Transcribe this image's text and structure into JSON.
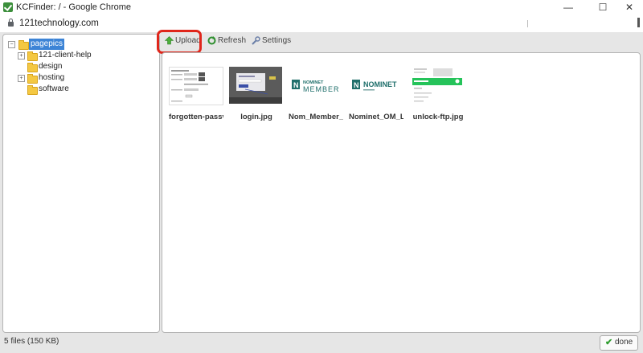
{
  "window": {
    "title": "KCFinder: / - Google Chrome",
    "controls": {
      "minimize": "—",
      "maximize": "☐",
      "close": "✕"
    }
  },
  "address_bar": {
    "url": "121technology.com"
  },
  "folder_tree": {
    "root": {
      "label": "pagepics",
      "icon": "folder-icon",
      "expanded": true,
      "selected": true
    },
    "items": [
      {
        "label": "121-client-help",
        "has_children": true
      },
      {
        "label": "design",
        "has_children": false
      },
      {
        "label": "hosting",
        "has_children": true
      },
      {
        "label": "software",
        "has_children": false
      }
    ]
  },
  "toolbar": {
    "upload_label": "Upload",
    "refresh_label": "Refresh",
    "settings_label": "Settings"
  },
  "files": [
    {
      "name": "forgotten-passv",
      "thumb": "form-screenshot"
    },
    {
      "name": "login.jpg",
      "thumb": "dark-screenshot"
    },
    {
      "name": "Nom_Member_",
      "thumb": "nominet-member-logo"
    },
    {
      "name": "Nominet_OM_L",
      "thumb": "nominet-logo"
    },
    {
      "name": "unlock-ftp.jpg",
      "thumb": "green-banner-screenshot"
    }
  ],
  "thumb_text": {
    "nominet_word": "NOMINET",
    "member_word": "MEMBER",
    "nominet_n": "N"
  },
  "status": {
    "text": "5 files (150 KB)"
  },
  "done_button": {
    "label": "done"
  },
  "colors": {
    "selection": "#3d84d6",
    "highlight_ring": "#e0261b",
    "folder": "#f4c842",
    "brand_teal": "#1f6f6b"
  }
}
